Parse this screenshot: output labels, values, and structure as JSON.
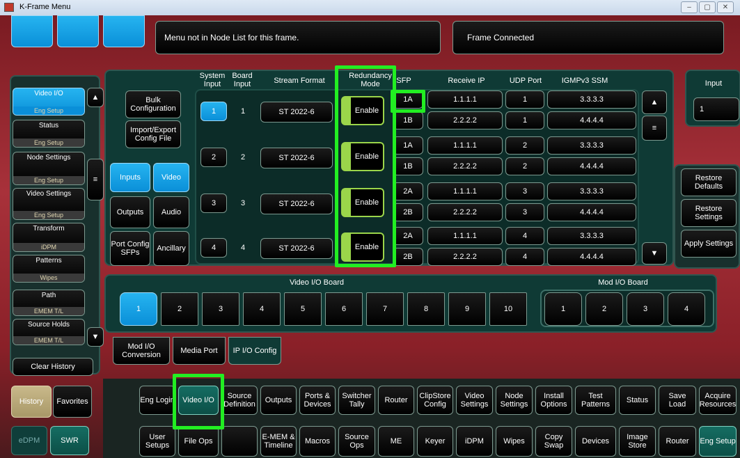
{
  "window": {
    "title": "K-Frame Menu",
    "minimize": "–",
    "maximize": "▢",
    "close": "✕"
  },
  "status": {
    "message": "Menu not in Node List for this frame.",
    "frame": "Frame Connected"
  },
  "left_nav": {
    "items": [
      {
        "label": "Video I/O",
        "sub": "Eng Setup"
      },
      {
        "label": "Status",
        "sub": "Eng Setup"
      },
      {
        "label": "Node Settings",
        "sub": "Eng Setup"
      },
      {
        "label": "Video Settings",
        "sub": "Eng Setup"
      },
      {
        "label": "Transform",
        "sub": "iDPM"
      },
      {
        "label": "Patterns",
        "sub": "Wipes"
      },
      {
        "label": "Path",
        "sub": "EMEM T/L"
      },
      {
        "label": "Source Holds",
        "sub": "EMEM T/L"
      }
    ],
    "clear_history": "Clear History",
    "history": "History",
    "favorites": "Favorites",
    "edpm": "eDPM",
    "swr": "SWR"
  },
  "config": {
    "bulk": "Bulk Configuration",
    "import_export": "Import/Export Config File",
    "inputs": "Inputs",
    "video": "Video",
    "outputs": "Outputs",
    "audio": "Audio",
    "port_config": "Port Config SFPs",
    "ancillary": "Ancillary"
  },
  "table": {
    "headers": {
      "system_input": "System Input",
      "board_input": "Board Input",
      "stream_format": "Stream Format",
      "redundancy": "Redundancy Mode",
      "sfp": "SFP",
      "receive_ip": "Receive IP",
      "udp_port": "UDP Port",
      "igmp": "IGMPv3 SSM"
    },
    "rows": [
      {
        "system": "1",
        "board": "1",
        "format": "ST 2022-6",
        "mode": "Enable",
        "sfp_a": "1A",
        "ip_a": "1.1.1.1",
        "udp_a": "1",
        "ssm_a": "3.3.3.3",
        "sfp_b": "1B",
        "ip_b": "2.2.2.2",
        "udp_b": "1",
        "ssm_b": "4.4.4.4"
      },
      {
        "system": "2",
        "board": "2",
        "format": "ST 2022-6",
        "mode": "Enable",
        "sfp_a": "1A",
        "ip_a": "1.1.1.1",
        "udp_a": "2",
        "ssm_a": "3.3.3.3",
        "sfp_b": "1B",
        "ip_b": "2.2.2.2",
        "udp_b": "2",
        "ssm_b": "4.4.4.4"
      },
      {
        "system": "3",
        "board": "3",
        "format": "ST 2022-6",
        "mode": "Enable",
        "sfp_a": "2A",
        "ip_a": "1.1.1.1",
        "udp_a": "3",
        "ssm_a": "3.3.3.3",
        "sfp_b": "2B",
        "ip_b": "2.2.2.2",
        "udp_b": "3",
        "ssm_b": "4.4.4.4"
      },
      {
        "system": "4",
        "board": "4",
        "format": "ST 2022-6",
        "mode": "Enable",
        "sfp_a": "2A",
        "ip_a": "1.1.1.1",
        "udp_a": "4",
        "ssm_a": "3.3.3.3",
        "sfp_b": "2B",
        "ip_b": "2.2.2.2",
        "udp_b": "4",
        "ssm_b": "4.4.4.4"
      }
    ]
  },
  "input_panel": {
    "label": "Input",
    "value": "1"
  },
  "right_actions": {
    "restore_defaults": "Restore Defaults",
    "restore_settings": "Restore Settings",
    "apply_settings": "Apply Settings"
  },
  "boards": {
    "video_title": "Video I/O Board",
    "video": [
      "1",
      "2",
      "3",
      "4",
      "5",
      "6",
      "7",
      "8",
      "9",
      "10"
    ],
    "mod_title": "Mod I/O Board",
    "mod": [
      "1",
      "2",
      "3",
      "4"
    ]
  },
  "sub_tabs": [
    "Mod I/O Conversion",
    "Media Port",
    "IP I/O Config"
  ],
  "bottom_row1": [
    "Eng Login",
    "Video I/O",
    "Source Definition",
    "Outputs",
    "Ports & Devices",
    "Switcher Tally",
    "Router",
    "ClipStore Config",
    "Video Settings",
    "Node Settings",
    "Install Options",
    "Test Patterns",
    "Status",
    "Save Load",
    "Acquire Resources"
  ],
  "bottom_row2": [
    "User Setups",
    "File Ops",
    "",
    "E-MEM & Timeline",
    "Macros",
    "Source Ops",
    "ME",
    "Keyer",
    "iDPM",
    "Wipes",
    "Copy Swap",
    "Devices",
    "Image Store",
    "Router",
    "Eng Setup"
  ],
  "colors": {
    "accent_blue": "#0a8fd8",
    "highlight": "#22ee22",
    "teal": "#0c4f47"
  }
}
